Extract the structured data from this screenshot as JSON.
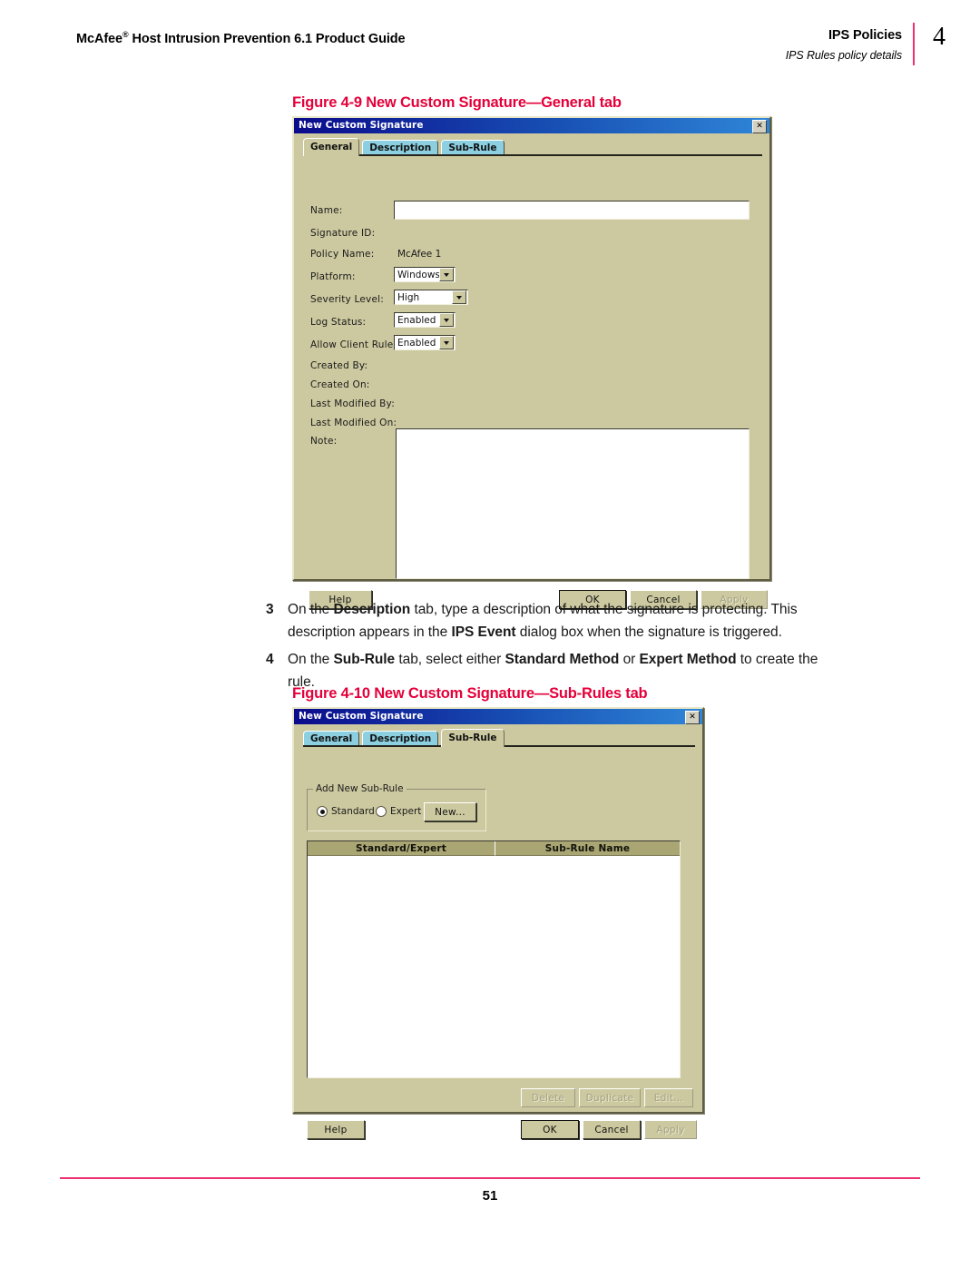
{
  "header": {
    "left_title": "McAfee",
    "left_title_sup": "®",
    "left_title_rest": " Host Intrusion Prevention 6.1 Product Guide",
    "right_title": "IPS Policies",
    "right_subtitle": "IPS Rules policy details",
    "chapter_number": "4"
  },
  "footer": {
    "page_number": "51"
  },
  "colors": {
    "accent_rule": "#ef2f6e",
    "caption_red": "#e4003a",
    "dialog_face": "#ccc9a0",
    "titlebar_navy": "#0b0b8c",
    "tab_inactive": "#8ccfe0",
    "listview_header": "#a9a673"
  },
  "figure_9": {
    "caption": "Figure 4-9  New Custom Signature—General tab",
    "dialog": {
      "title": "New Custom Signature",
      "close_label": "✕",
      "tabs": [
        {
          "label": "General",
          "active": true
        },
        {
          "label": "Description",
          "active": false
        },
        {
          "label": "Sub-Rule",
          "active": false
        }
      ],
      "fields": [
        {
          "label": "Name:",
          "type": "textbox",
          "value": ""
        },
        {
          "label": "Signature ID:",
          "type": "static",
          "value": ""
        },
        {
          "label": "Policy Name:",
          "type": "static",
          "value": "McAfee 1"
        },
        {
          "label": "Platform:",
          "type": "combo",
          "value": "Windows"
        },
        {
          "label": "Severity Level:",
          "type": "combo",
          "value": "High"
        },
        {
          "label": "Log Status:",
          "type": "combo",
          "value": "Enabled"
        },
        {
          "label": "Allow Client Rules:",
          "type": "combo",
          "value": "Enabled"
        },
        {
          "label": "Created By:",
          "type": "static",
          "value": ""
        },
        {
          "label": "Created On:",
          "type": "static",
          "value": ""
        },
        {
          "label": "Last Modified By:",
          "type": "static",
          "value": ""
        },
        {
          "label": "Last Modified On:",
          "type": "static",
          "value": ""
        },
        {
          "label": "Note:",
          "type": "textarea",
          "value": ""
        }
      ],
      "buttons": {
        "help": "Help",
        "ok": "OK",
        "cancel": "Cancel",
        "apply": "Apply"
      }
    }
  },
  "steps": [
    {
      "number": "3",
      "line1_a": "On the ",
      "line1_b": "Description",
      "line1_c": " tab, type a description of what the signature is protecting. This",
      "line2_a": "description appears in the ",
      "line2_b": "IPS Event",
      "line2_c": " dialog box when the signature is triggered."
    },
    {
      "number": "4",
      "line1_a": "On the ",
      "line1_b": "Sub-Rule",
      "line1_c": " tab, select either ",
      "line1_d": "Standard Method",
      "line1_e": " or ",
      "line1_f": "Expert Method",
      "line1_g": " to create the rule."
    }
  ],
  "figure_10": {
    "caption": "Figure 4-10  New Custom Signature—Sub-Rules tab",
    "dialog": {
      "title": "New Custom Signature",
      "close_label": "✕",
      "tabs": [
        {
          "label": "General",
          "active": false
        },
        {
          "label": "Description",
          "active": false
        },
        {
          "label": "Sub-Rule",
          "active": true
        }
      ],
      "groupbox": {
        "title": "Add New Sub-Rule",
        "radios": [
          {
            "label": "Standard",
            "checked": true
          },
          {
            "label": "Expert",
            "checked": false
          }
        ],
        "new_button": "New..."
      },
      "listview": {
        "columns": [
          "Standard/Expert",
          "Sub-Rule Name"
        ],
        "rows": []
      },
      "row_buttons": {
        "delete": "Delete",
        "duplicate": "Duplicate",
        "edit": "Edit..."
      },
      "buttons": {
        "help": "Help",
        "ok": "OK",
        "cancel": "Cancel",
        "apply": "Apply"
      }
    }
  }
}
